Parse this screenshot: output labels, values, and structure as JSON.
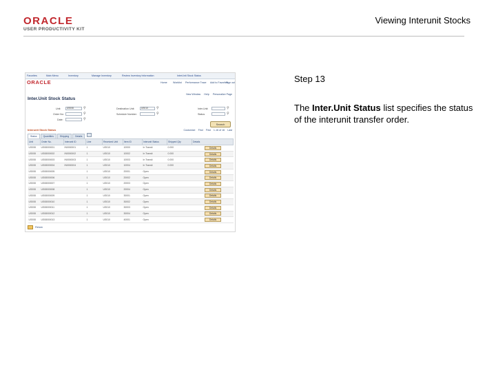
{
  "logo": {
    "brand": "ORACLE",
    "product": "USER PRODUCTIVITY KIT"
  },
  "doc_title": "Viewing Interunit Stocks",
  "step": {
    "label": "Step 13",
    "desc_prefix": "The ",
    "desc_bold": "Inter.Unit Status",
    "desc_suffix": " list specifies the status of the interunit transfer order."
  },
  "screenshot": {
    "nav_breadcrumb": [
      "Favorites",
      "Main Menu",
      "Inventory",
      "Manage Inventory",
      "Review Inventory Information",
      "InterUnit Stock Status"
    ],
    "menu_links": [
      "Home",
      "Worklist",
      "Performance Trace",
      "Add to Favorites",
      "Sign out"
    ],
    "page_links": [
      "New Window",
      "Help",
      "Personalize Page"
    ],
    "brand": "ORACLE",
    "page_title": "Inter.Unit Stock Status",
    "filters": {
      "unit_label": "Unit:",
      "unit_value": "US008",
      "order_label": "Order No:",
      "date_label": "Date:",
      "dest_unit_label": "Destination Unit:",
      "dest_unit_value": "US010",
      "schedule_label": "Schedule Number:",
      "status_label": "Inter.Unit:",
      "status_value": "Status"
    },
    "search_button": "Search",
    "grid": {
      "title": "Interunit Stock Status",
      "nav": [
        "Customize",
        "Find",
        "First",
        "1-16 of 16",
        "Last"
      ],
      "tabs": [
        "Status",
        "Quantities",
        "Shipping",
        "Details"
      ],
      "headers": [
        "Unit",
        "Order No.",
        "Interunit ID",
        "Line",
        "Received Unit",
        "Item ID",
        "Interunit Status",
        "Shipped Qty",
        "Details"
      ],
      "rows": [
        [
          "US008",
          "US08000001",
          "IN0000001",
          "1",
          "US010",
          "10000",
          "In Transit",
          "0.000",
          "Details"
        ],
        [
          "US008",
          "US08000002",
          "IN0000002",
          "1",
          "US010",
          "10002",
          "In Transit",
          "0.000",
          "Details"
        ],
        [
          "US008",
          "US08000003",
          "IN0000003",
          "1",
          "US010",
          "10003",
          "In Transit",
          "0.000",
          "Details"
        ],
        [
          "US008",
          "US08000004",
          "IN0000004",
          "1",
          "US010",
          "10004",
          "In Transit",
          "0.000",
          "Details"
        ],
        [
          "US008",
          "US08000005",
          "",
          "1",
          "US010",
          "20001",
          "Open",
          "",
          "Details"
        ],
        [
          "US008",
          "US08000006",
          "",
          "1",
          "US010",
          "20002",
          "Open",
          "",
          "Details"
        ],
        [
          "US008",
          "US08000007",
          "",
          "1",
          "US010",
          "20003",
          "Open",
          "",
          "Details"
        ],
        [
          "US008",
          "US08000008",
          "",
          "1",
          "US010",
          "20004",
          "Open",
          "",
          "Details"
        ],
        [
          "US008",
          "US08000009",
          "",
          "1",
          "US010",
          "30001",
          "Open",
          "",
          "Details"
        ],
        [
          "US008",
          "US08000010",
          "",
          "1",
          "US010",
          "30002",
          "Open",
          "",
          "Details"
        ],
        [
          "US008",
          "US08000011",
          "",
          "1",
          "US010",
          "30003",
          "Open",
          "",
          "Details"
        ],
        [
          "US008",
          "US08000012",
          "",
          "1",
          "US010",
          "30004",
          "Open",
          "",
          "Details"
        ],
        [
          "US008",
          "US08000013",
          "",
          "1",
          "US010",
          "40001",
          "Open",
          "",
          "Details"
        ]
      ]
    },
    "bottom_button": "Return"
  }
}
